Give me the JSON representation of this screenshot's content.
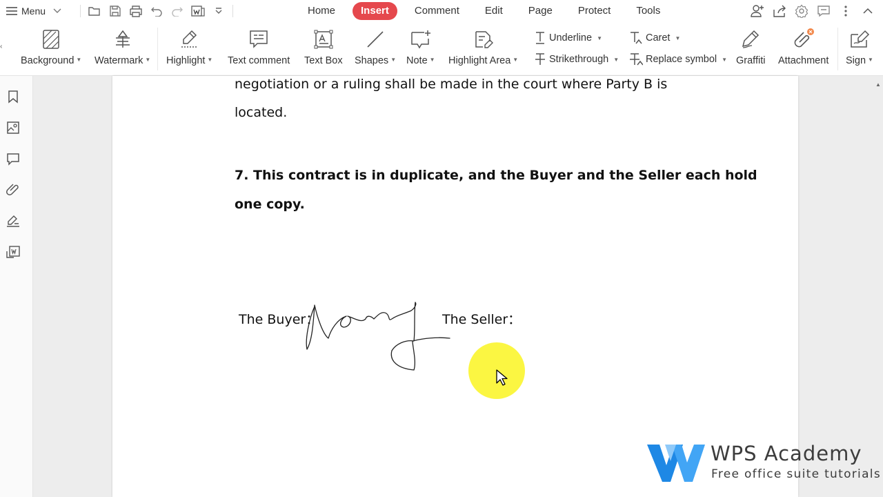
{
  "topbar": {
    "menu_label": "Menu",
    "quick_icons": [
      "open-folder-icon",
      "save-icon",
      "print-icon",
      "undo-icon",
      "redo-icon",
      "export-to-word-icon",
      "customize-dropdown-icon"
    ],
    "tabs": [
      {
        "label": "Home",
        "active": false
      },
      {
        "label": "Insert",
        "active": true
      },
      {
        "label": "Comment",
        "active": false
      },
      {
        "label": "Edit",
        "active": false
      },
      {
        "label": "Page",
        "active": false
      },
      {
        "label": "Protect",
        "active": false
      },
      {
        "label": "Tools",
        "active": false
      }
    ],
    "right_icons": [
      "add-user-icon",
      "share-icon",
      "settings-icon",
      "feedback-icon",
      "more-icon",
      "collapse-icon"
    ]
  },
  "ribbon": {
    "background": "Background",
    "watermark": "Watermark",
    "highlight": "Highlight",
    "text_comment": "Text comment",
    "text_box": "Text Box",
    "shapes": "Shapes",
    "note": "Note",
    "highlight_area": "Highlight Area",
    "underline": "Underline",
    "strikethrough": "Strikethrough",
    "caret": "Caret",
    "replace_symbol": "Replace symbol",
    "graffiti": "Graffiti",
    "attachment": "Attachment",
    "sign": "Sign"
  },
  "sidebar": {
    "icons": [
      "bookmark-icon",
      "image-icon",
      "comment-icon",
      "attachment-icon",
      "signature-icon",
      "convert-icon"
    ]
  },
  "document": {
    "line1": "negotiation or a ruling shall be made in the court where Party B is",
    "line2": "located.",
    "clause7_line1": "7. This contract is in duplicate, and  the Buyer and the Seller  each hold",
    "clause7_line2": "one copy.",
    "buyer_label": "The Buyer：",
    "seller_label": "The Seller："
  },
  "watermark": {
    "title": "WPS Academy",
    "subtitle": "Free office suite tutorials"
  },
  "colors": {
    "accent": "#e5484d",
    "logo_blue": "#1e88e5",
    "cursor_glow": "#faf528"
  }
}
